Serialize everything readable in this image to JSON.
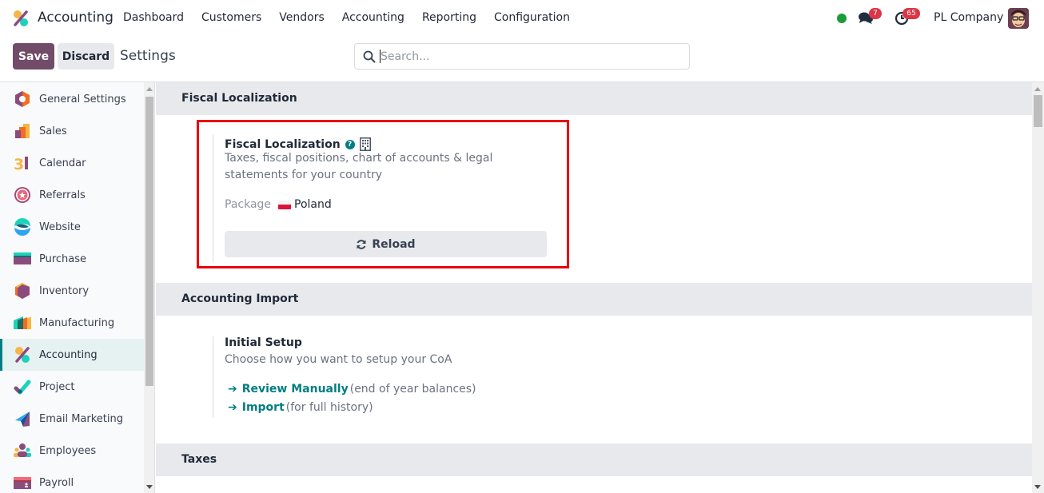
{
  "navbar": {
    "app_name": "Accounting",
    "menu": [
      "Dashboard",
      "Customers",
      "Vendors",
      "Accounting",
      "Reporting",
      "Configuration"
    ],
    "status_color": "#1a9c3a",
    "messages_badge": "7",
    "activities_badge": "65",
    "company": "PL Company"
  },
  "control": {
    "save_label": "Save",
    "discard_label": "Discard",
    "breadcrumb": "Settings",
    "search_placeholder": "Search...",
    "search_value": ""
  },
  "sidebar": {
    "items": [
      {
        "label": "General Settings",
        "icon": "general-settings-icon"
      },
      {
        "label": "Sales",
        "icon": "sales-icon"
      },
      {
        "label": "Calendar",
        "icon": "calendar-icon"
      },
      {
        "label": "Referrals",
        "icon": "referrals-icon"
      },
      {
        "label": "Website",
        "icon": "website-icon"
      },
      {
        "label": "Purchase",
        "icon": "purchase-icon"
      },
      {
        "label": "Inventory",
        "icon": "inventory-icon"
      },
      {
        "label": "Manufacturing",
        "icon": "manufacturing-icon"
      },
      {
        "label": "Accounting",
        "icon": "accounting-icon",
        "active": true
      },
      {
        "label": "Project",
        "icon": "project-icon"
      },
      {
        "label": "Email Marketing",
        "icon": "email-marketing-icon"
      },
      {
        "label": "Employees",
        "icon": "employees-icon"
      },
      {
        "label": "Payroll",
        "icon": "payroll-icon"
      }
    ]
  },
  "sections": {
    "fiscal": {
      "header": "Fiscal Localization",
      "title": "Fiscal Localization",
      "help": "?",
      "description": "Taxes, fiscal positions, chart of accounts & legal statements for your country",
      "package_label": "Package",
      "package_value": "Poland",
      "reload_label": "Reload"
    },
    "import": {
      "header": "Accounting Import",
      "title": "Initial Setup",
      "description": "Choose how you want to setup your CoA",
      "links": [
        {
          "arrow": "➔",
          "label": "Review Manually",
          "note": "(end of year balances)"
        },
        {
          "arrow": "➔",
          "label": "Import",
          "note": "(for full history)"
        }
      ]
    },
    "taxes": {
      "header": "Taxes"
    }
  },
  "colors": {
    "brand": "#714b67",
    "accent": "#017e84",
    "highlight": "#e8000b"
  }
}
